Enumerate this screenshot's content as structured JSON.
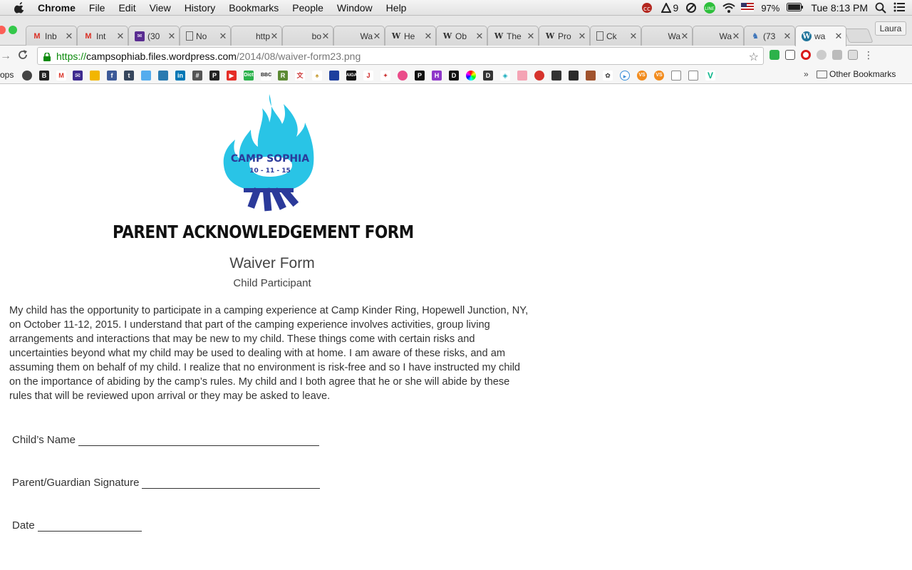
{
  "menubar": {
    "app_name": "Chrome",
    "items": [
      "File",
      "Edit",
      "View",
      "History",
      "Bookmarks",
      "People",
      "Window",
      "Help"
    ],
    "status": {
      "notification_count": "9",
      "battery": "97%",
      "clock": "Tue 8:13 PM"
    }
  },
  "tabs": [
    {
      "label": "Inb",
      "icon": "gmail-icon"
    },
    {
      "label": "Int",
      "icon": "gmail-icon"
    },
    {
      "label": "(30",
      "icon": "yahoo-mail-icon"
    },
    {
      "label": "No",
      "icon": "document-icon"
    },
    {
      "label": "http",
      "icon": "none"
    },
    {
      "label": "bo",
      "icon": "none"
    },
    {
      "label": "Wa",
      "icon": "none"
    },
    {
      "label": "He",
      "icon": "wikipedia-icon"
    },
    {
      "label": "Ob",
      "icon": "wikipedia-icon"
    },
    {
      "label": "The",
      "icon": "wikipedia-icon"
    },
    {
      "label": "Pro",
      "icon": "wikipedia-icon"
    },
    {
      "label": "Ck",
      "icon": "document-icon"
    },
    {
      "label": "Wa",
      "icon": "none"
    },
    {
      "label": "Wa",
      "icon": "none"
    },
    {
      "label": "(73",
      "icon": "bird-icon"
    },
    {
      "label": "wa",
      "icon": "wordpress-icon",
      "active": true
    }
  ],
  "profile": "Laura",
  "omnibox": {
    "url_scheme": "https://",
    "url_host": "campsophiab.files.wordpress.com",
    "url_path": "/2014/08/waiver-form23.png"
  },
  "bookmarks": {
    "apps_label": "ops",
    "other_label": "Other Bookmarks",
    "more_label": "»"
  },
  "form": {
    "logo_text": "CAMP SOPHIA",
    "logo_date": "10 - 11 - 15",
    "title": "PARENT ACKNOWLEDGEMENT FORM",
    "subtitle": "Waiver Form",
    "subsubtitle": "Child Participant",
    "body_lines": [
      "My child has the opportunity to participate in a camping experience at Camp Kinder Ring, Hopewell Junction, NY,",
      "on  October 11-12, 2015.  I understand that part of the camping experience involves activities, group living",
      "arrangements and interactions that may be new to my child. These things come with certain risks and",
      "uncertainties beyond what my child may be used to dealing with at home. I am aware of  these risks, and am",
      "assuming them on behalf of my child. I realize that no environment is risk-free and so I have instructed my child",
      "on the importance of abiding by the camp’s rules. My child and I both agree that he or she will abide by these",
      "rules that will be reviewed upon arrival  or they may be asked to leave."
    ],
    "child_name_label": "Child’s Name",
    "parent_signature_label": "Parent/Guardian Signature",
    "date_label": "Date"
  },
  "colors": {
    "flame": "#29c4e6",
    "logo_text": "#2b3a9a",
    "url_green": "#0b8a0b"
  }
}
